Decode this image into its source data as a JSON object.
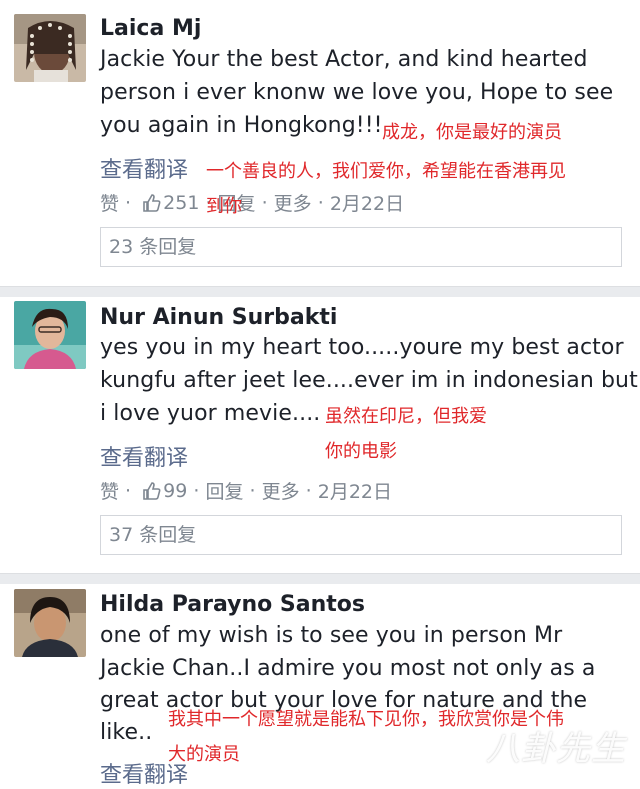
{
  "comments": [
    {
      "author": "Laica Mj",
      "lines": [
        "Jackie Your the best Actor, and kind hearted",
        "person i ever knonw we love you, Hope to see",
        "you again in Hongkong!!!"
      ],
      "translate_label": "查看翻译",
      "like_label": "赞",
      "like_count": "251",
      "reply_label": "回复",
      "more_label": "更多",
      "date": "2月22日",
      "replies_label": "23 条回复",
      "notes": [
        "成龙，你是最好的演员",
        "一个善良的人，我们爱你，希望能在香港再见",
        "到你"
      ]
    },
    {
      "author": "Nur Ainun Surbakti",
      "lines": [
        "yes you in my heart too.....youre my best actor",
        "kungfu after jeet lee....ever im in indonesian but",
        "i love yuor mevie...."
      ],
      "translate_label": "查看翻译",
      "like_label": "赞",
      "like_count": "99",
      "reply_label": "回复",
      "more_label": "更多",
      "date": "2月22日",
      "replies_label": "37 条回复",
      "notes": [
        "虽然在印尼，但我爱",
        "你的电影"
      ]
    },
    {
      "author": "Hilda Parayno Santos",
      "lines": [
        "one of my wish is to see you in person Mr",
        "Jackie Chan..I admire you most not only as a",
        "great actor but your love for nature and the",
        "like.."
      ],
      "translate_label": "查看翻译",
      "notes": [
        "我其中一个愿望就是能私下见你，我欣赏你是个伟",
        "大的演员"
      ]
    }
  ],
  "watermark": "八卦先生",
  "colors": {
    "annotation": "#e0282b",
    "link": "#5b6b8c",
    "meta": "#7f8791"
  }
}
